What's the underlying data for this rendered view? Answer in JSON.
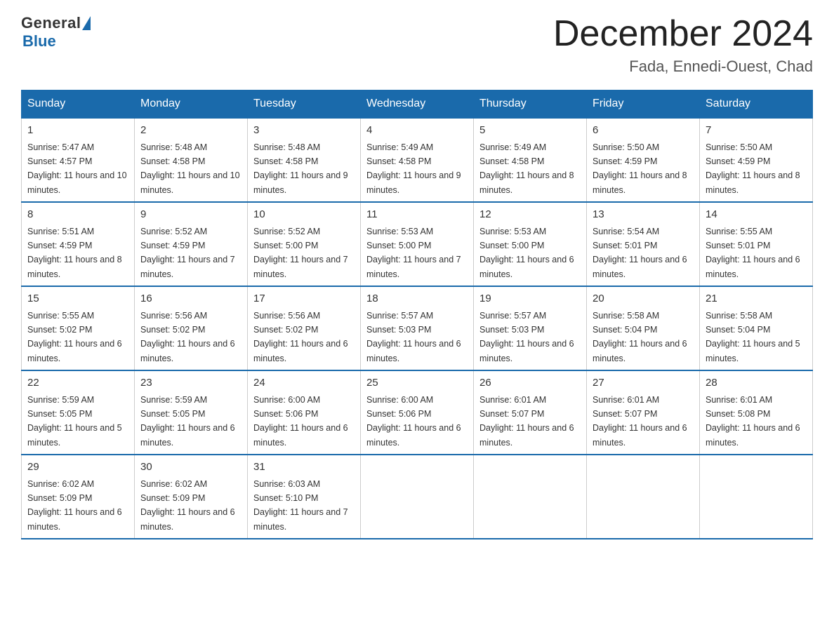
{
  "logo": {
    "general": "General",
    "blue": "Blue"
  },
  "title": "December 2024",
  "location": "Fada, Ennedi-Ouest, Chad",
  "days_of_week": [
    "Sunday",
    "Monday",
    "Tuesday",
    "Wednesday",
    "Thursday",
    "Friday",
    "Saturday"
  ],
  "weeks": [
    [
      {
        "day": "1",
        "sunrise": "5:47 AM",
        "sunset": "4:57 PM",
        "daylight": "11 hours and 10 minutes."
      },
      {
        "day": "2",
        "sunrise": "5:48 AM",
        "sunset": "4:58 PM",
        "daylight": "11 hours and 10 minutes."
      },
      {
        "day": "3",
        "sunrise": "5:48 AM",
        "sunset": "4:58 PM",
        "daylight": "11 hours and 9 minutes."
      },
      {
        "day": "4",
        "sunrise": "5:49 AM",
        "sunset": "4:58 PM",
        "daylight": "11 hours and 9 minutes."
      },
      {
        "day": "5",
        "sunrise": "5:49 AM",
        "sunset": "4:58 PM",
        "daylight": "11 hours and 8 minutes."
      },
      {
        "day": "6",
        "sunrise": "5:50 AM",
        "sunset": "4:59 PM",
        "daylight": "11 hours and 8 minutes."
      },
      {
        "day": "7",
        "sunrise": "5:50 AM",
        "sunset": "4:59 PM",
        "daylight": "11 hours and 8 minutes."
      }
    ],
    [
      {
        "day": "8",
        "sunrise": "5:51 AM",
        "sunset": "4:59 PM",
        "daylight": "11 hours and 8 minutes."
      },
      {
        "day": "9",
        "sunrise": "5:52 AM",
        "sunset": "4:59 PM",
        "daylight": "11 hours and 7 minutes."
      },
      {
        "day": "10",
        "sunrise": "5:52 AM",
        "sunset": "5:00 PM",
        "daylight": "11 hours and 7 minutes."
      },
      {
        "day": "11",
        "sunrise": "5:53 AM",
        "sunset": "5:00 PM",
        "daylight": "11 hours and 7 minutes."
      },
      {
        "day": "12",
        "sunrise": "5:53 AM",
        "sunset": "5:00 PM",
        "daylight": "11 hours and 6 minutes."
      },
      {
        "day": "13",
        "sunrise": "5:54 AM",
        "sunset": "5:01 PM",
        "daylight": "11 hours and 6 minutes."
      },
      {
        "day": "14",
        "sunrise": "5:55 AM",
        "sunset": "5:01 PM",
        "daylight": "11 hours and 6 minutes."
      }
    ],
    [
      {
        "day": "15",
        "sunrise": "5:55 AM",
        "sunset": "5:02 PM",
        "daylight": "11 hours and 6 minutes."
      },
      {
        "day": "16",
        "sunrise": "5:56 AM",
        "sunset": "5:02 PM",
        "daylight": "11 hours and 6 minutes."
      },
      {
        "day": "17",
        "sunrise": "5:56 AM",
        "sunset": "5:02 PM",
        "daylight": "11 hours and 6 minutes."
      },
      {
        "day": "18",
        "sunrise": "5:57 AM",
        "sunset": "5:03 PM",
        "daylight": "11 hours and 6 minutes."
      },
      {
        "day": "19",
        "sunrise": "5:57 AM",
        "sunset": "5:03 PM",
        "daylight": "11 hours and 6 minutes."
      },
      {
        "day": "20",
        "sunrise": "5:58 AM",
        "sunset": "5:04 PM",
        "daylight": "11 hours and 6 minutes."
      },
      {
        "day": "21",
        "sunrise": "5:58 AM",
        "sunset": "5:04 PM",
        "daylight": "11 hours and 5 minutes."
      }
    ],
    [
      {
        "day": "22",
        "sunrise": "5:59 AM",
        "sunset": "5:05 PM",
        "daylight": "11 hours and 5 minutes."
      },
      {
        "day": "23",
        "sunrise": "5:59 AM",
        "sunset": "5:05 PM",
        "daylight": "11 hours and 6 minutes."
      },
      {
        "day": "24",
        "sunrise": "6:00 AM",
        "sunset": "5:06 PM",
        "daylight": "11 hours and 6 minutes."
      },
      {
        "day": "25",
        "sunrise": "6:00 AM",
        "sunset": "5:06 PM",
        "daylight": "11 hours and 6 minutes."
      },
      {
        "day": "26",
        "sunrise": "6:01 AM",
        "sunset": "5:07 PM",
        "daylight": "11 hours and 6 minutes."
      },
      {
        "day": "27",
        "sunrise": "6:01 AM",
        "sunset": "5:07 PM",
        "daylight": "11 hours and 6 minutes."
      },
      {
        "day": "28",
        "sunrise": "6:01 AM",
        "sunset": "5:08 PM",
        "daylight": "11 hours and 6 minutes."
      }
    ],
    [
      {
        "day": "29",
        "sunrise": "6:02 AM",
        "sunset": "5:09 PM",
        "daylight": "11 hours and 6 minutes."
      },
      {
        "day": "30",
        "sunrise": "6:02 AM",
        "sunset": "5:09 PM",
        "daylight": "11 hours and 6 minutes."
      },
      {
        "day": "31",
        "sunrise": "6:03 AM",
        "sunset": "5:10 PM",
        "daylight": "11 hours and 7 minutes."
      },
      null,
      null,
      null,
      null
    ]
  ]
}
